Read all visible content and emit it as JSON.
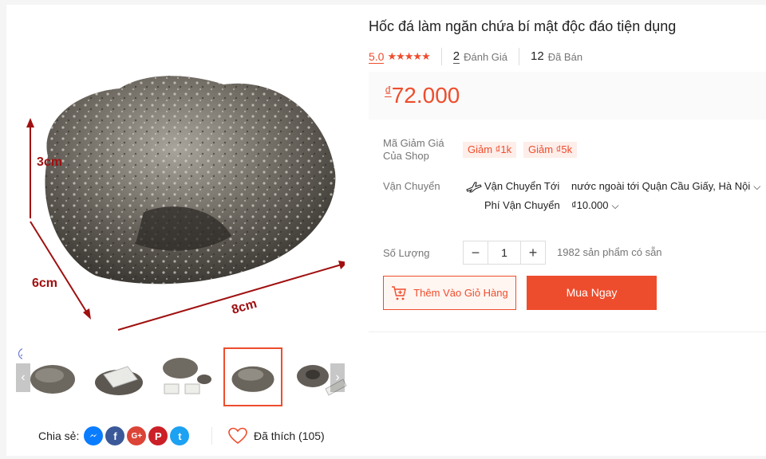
{
  "product": {
    "title": "Hốc đá làm ngăn chứa bí mật độc đáo tiện dụng",
    "rating": "5.0",
    "stars": "★★★★★",
    "review_count": "2",
    "review_label": "Đánh Giá",
    "sold_count": "12",
    "sold_label": "Đã Bán"
  },
  "price": {
    "currency": "₫",
    "amount": "72.000"
  },
  "vouchers": {
    "label": "Mã Giảm Giá Của Shop",
    "items": [
      "Giảm ₫1k",
      "Giảm ₫5k"
    ]
  },
  "shipping": {
    "label": "Vận Chuyển",
    "from_label": "Vận Chuyển Tới",
    "destination": "nước ngoài tới Quận Cầu Giấy, Hà Nội",
    "fee_label": "Phí Vận Chuyển",
    "fee": "₫10.000"
  },
  "quantity": {
    "label": "Số Lượng",
    "minus": "−",
    "value": "1",
    "plus": "+",
    "stock": "1982 sản phẩm có sẵn"
  },
  "actions": {
    "add_to_cart": "Thêm Vào Giỏ Hàng",
    "buy_now": "Mua Ngay"
  },
  "image": {
    "dim_height": "3cm",
    "dim_depth": "6cm",
    "dim_width": "8cm"
  },
  "gallery": {
    "prev": "‹",
    "next": "›",
    "active_index": 3
  },
  "share": {
    "label": "Chia sẻ:",
    "networks": [
      "messenger",
      "facebook",
      "google-plus",
      "pinterest",
      "twitter"
    ],
    "letters": {
      "facebook": "f",
      "google": "G+",
      "pinterest": "P",
      "twitter": "t"
    }
  },
  "favorite": {
    "label": "Đã thích (105)"
  },
  "colors": {
    "accent": "#ee4d2d",
    "messenger": "#0a7cff",
    "facebook": "#3b5998",
    "google": "#db4437",
    "pinterest": "#cb2027",
    "twitter": "#1da1f2"
  }
}
